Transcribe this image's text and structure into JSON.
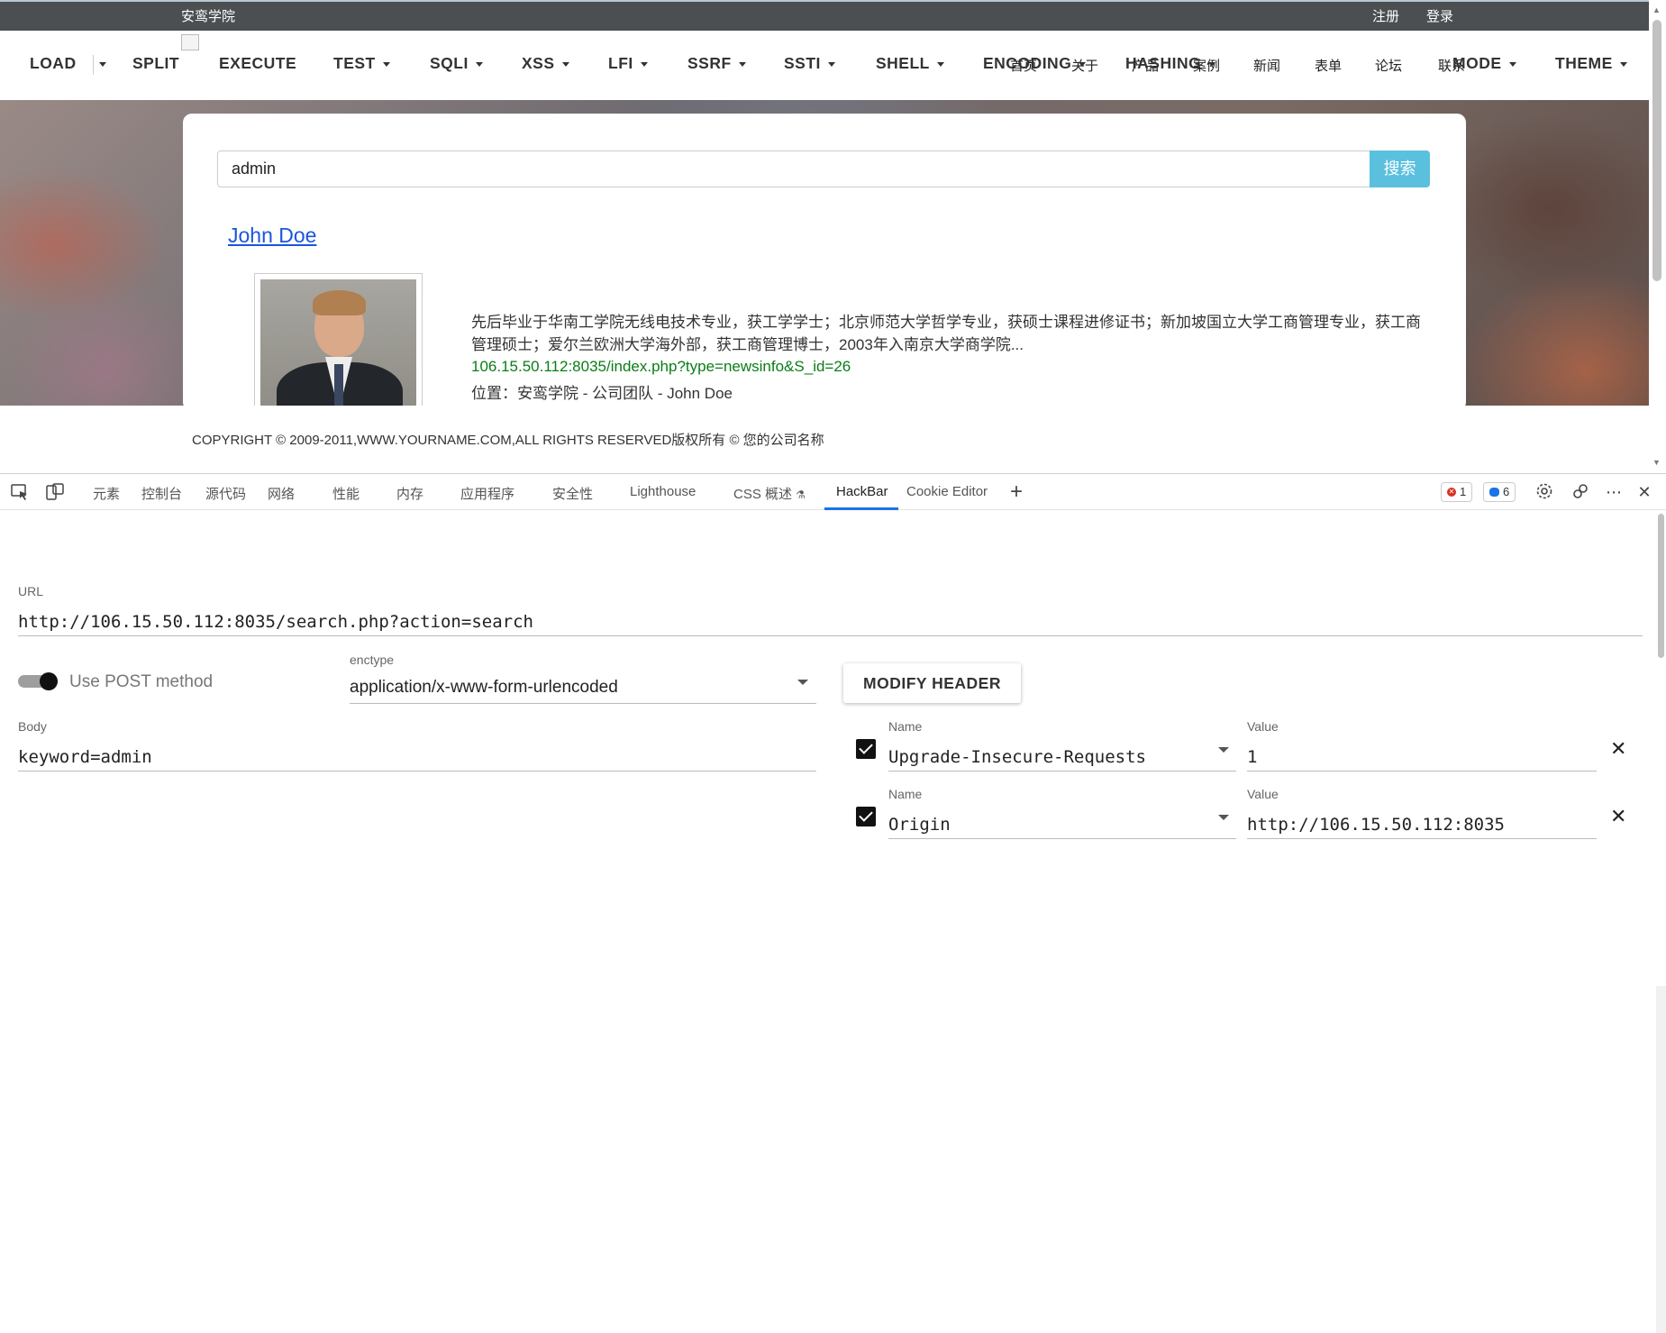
{
  "site": {
    "name": "安鸾学院",
    "register": "注册",
    "login": "登录",
    "nav": [
      "首页",
      "关于",
      "产品",
      "案例",
      "新闻",
      "表单",
      "论坛",
      "联系"
    ]
  },
  "search": {
    "value": "admin",
    "button": "搜索"
  },
  "result": {
    "title": "John Doe",
    "description": "先后毕业于华南工学院无线电技术专业，获工学学士；北京师范大学哲学专业，获硕士课程进修证书；新加坡国立大学工商管理专业，获工商管理硕士；爱尔兰欧洲大学海外部，获工商管理博士，2003年入南京大学商学院...",
    "url": "106.15.50.112:8035/index.php?type=newsinfo&S_id=26",
    "location": "位置：安鸾学院 - 公司团队 - John Doe"
  },
  "footer": {
    "copyright": "COPYRIGHT © 2009-2011,WWW.YOURNAME.COM,ALL RIGHTS RESERVED版权所有 © 您的公司名称"
  },
  "devtools": {
    "tabs": [
      "元素",
      "控制台",
      "源代码",
      "网络",
      "性能",
      "内存",
      "应用程序",
      "安全性",
      "Lighthouse",
      "CSS 概述",
      "HackBar",
      "Cookie Editor"
    ],
    "active_tab": "HackBar",
    "error_count": "1",
    "info_count": "6"
  },
  "hackbar": {
    "toolbar": [
      "LOAD",
      "SPLIT",
      "EXECUTE",
      "TEST",
      "SQLI",
      "XSS",
      "LFI",
      "SSRF",
      "SSTI",
      "SHELL",
      "ENCODING",
      "HASHING",
      "MODE",
      "THEME"
    ],
    "url_label": "URL",
    "url": "http://106.15.50.112:8035/search.php?action=search",
    "post_label": "Use POST method",
    "post_enabled": true,
    "enctype_label": "enctype",
    "enctype": "application/x-www-form-urlencoded",
    "modify_header": "MODIFY HEADER",
    "body_label": "Body",
    "body": "keyword=admin",
    "headers": [
      {
        "name_label": "Name",
        "name": "Upgrade-Insecure-Requests",
        "value_label": "Value",
        "value": "1",
        "enabled": true
      },
      {
        "name_label": "Name",
        "name": "Origin",
        "value_label": "Value",
        "value": "http://106.15.50.112:8035",
        "enabled": true
      }
    ]
  },
  "colors": {
    "topbar": "#4b4f52",
    "search_button": "#5bc0de",
    "link": "#1a56db",
    "result_url": "#0a7d16",
    "devtools_accent": "#1a73e8"
  }
}
